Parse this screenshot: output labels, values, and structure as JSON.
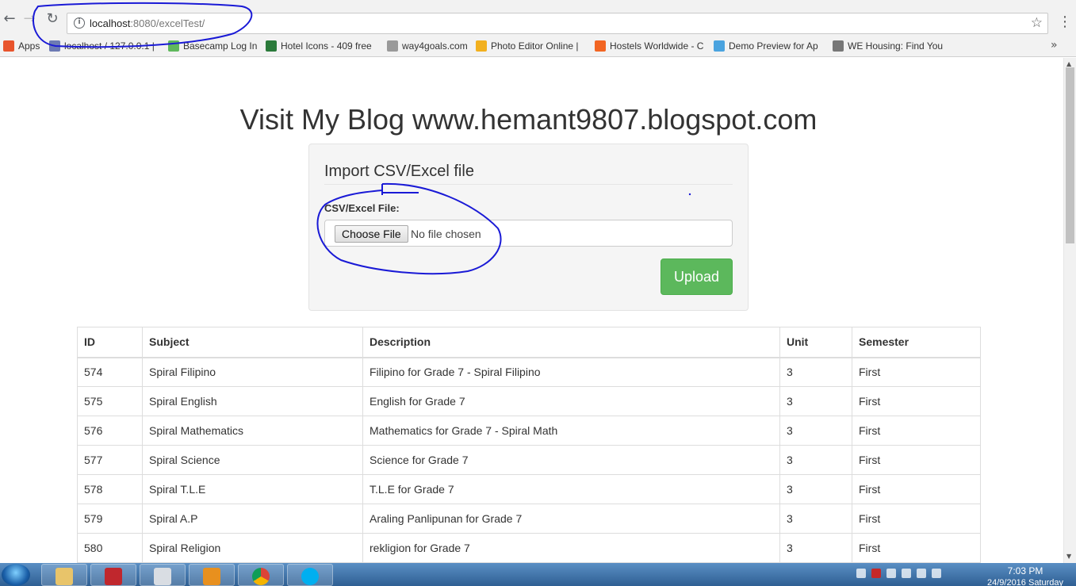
{
  "browser": {
    "url_host": "localhost",
    "url_rest": ":8080/excelTest/",
    "bookmarks": [
      {
        "label": "Apps",
        "color": "#e8542c"
      },
      {
        "label": "localhost / 127.0.0.1 |",
        "color": "#6c7ab3"
      },
      {
        "label": "Basecamp Log In",
        "color": "#5fb85c"
      },
      {
        "label": "Hotel Icons - 409 free",
        "color": "#2a7a3a"
      },
      {
        "label": "way4goals.com",
        "color": "#999999"
      },
      {
        "label": "Photo Editor Online |",
        "color": "#f2b01e"
      },
      {
        "label": "Hostels Worldwide - C",
        "color": "#f26522"
      },
      {
        "label": "Demo Preview for Ap",
        "color": "#4aa3df"
      },
      {
        "label": "WE Housing: Find You",
        "color": "#777777"
      }
    ]
  },
  "page": {
    "heading": "Visit My Blog www.hemant9807.blogspot.com",
    "import_panel": {
      "title": "Import CSV/Excel file",
      "field_label": "CSV/Excel File:",
      "choose_button": "Choose File",
      "file_status": "No file chosen",
      "upload_button": "Upload"
    },
    "table": {
      "headers": [
        "ID",
        "Subject",
        "Description",
        "Unit",
        "Semester"
      ],
      "rows": [
        [
          "574",
          "Spiral Filipino",
          "Filipino for Grade 7 - Spiral Filipino",
          "3",
          "First"
        ],
        [
          "575",
          "Spiral English",
          "English for Grade 7",
          "3",
          "First"
        ],
        [
          "576",
          "Spiral Mathematics",
          "Mathematics for Grade 7 - Spiral Math",
          "3",
          "First"
        ],
        [
          "577",
          "Spiral Science",
          "Science for Grade 7",
          "3",
          "First"
        ],
        [
          "578",
          "Spiral T.L.E",
          "T.L.E for Grade 7",
          "3",
          "First"
        ],
        [
          "579",
          "Spiral A.P",
          "Araling Panlipunan for Grade 7",
          "3",
          "First"
        ],
        [
          "580",
          "Spiral Religion",
          "rekligion for Grade 7",
          "3",
          "First"
        ]
      ]
    }
  },
  "taskbar": {
    "time": "7:03 PM",
    "date": "24/9/2016 Saturday"
  },
  "colors": {
    "upload_button": "#5cb85c",
    "annotation_ink": "#1a1ad6"
  }
}
